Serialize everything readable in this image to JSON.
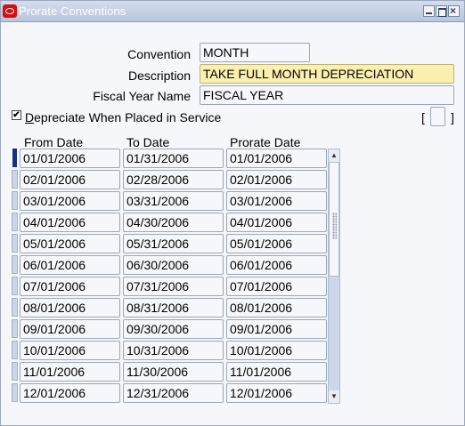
{
  "window": {
    "title": "Prorate Conventions",
    "close_glyph": "×"
  },
  "form": {
    "convention_label": "Convention",
    "convention_value": "MONTH",
    "description_label": "Description",
    "description_value": "TAKE FULL MONTH DEPRECIATION",
    "fiscal_year_label": "Fiscal Year Name",
    "fiscal_year_value": "FISCAL YEAR",
    "depreciate_checked": true,
    "depreciate_check_glyph": "✔",
    "depreciate_label_mnemonic": "D",
    "depreciate_label_rest": "epreciate When Placed in Service",
    "flexfield_open": "[",
    "flexfield_close": "]"
  },
  "table": {
    "headers": {
      "from": "From Date",
      "to": "To Date",
      "prorate": "Prorate Date"
    },
    "rows": [
      {
        "from": "01/01/2006",
        "to": "01/31/2006",
        "prorate": "01/01/2006"
      },
      {
        "from": "02/01/2006",
        "to": "02/28/2006",
        "prorate": "02/01/2006"
      },
      {
        "from": "03/01/2006",
        "to": "03/31/2006",
        "prorate": "03/01/2006"
      },
      {
        "from": "04/01/2006",
        "to": "04/30/2006",
        "prorate": "04/01/2006"
      },
      {
        "from": "05/01/2006",
        "to": "05/31/2006",
        "prorate": "05/01/2006"
      },
      {
        "from": "06/01/2006",
        "to": "06/30/2006",
        "prorate": "06/01/2006"
      },
      {
        "from": "07/01/2006",
        "to": "07/31/2006",
        "prorate": "07/01/2006"
      },
      {
        "from": "08/01/2006",
        "to": "08/31/2006",
        "prorate": "08/01/2006"
      },
      {
        "from": "09/01/2006",
        "to": "09/30/2006",
        "prorate": "09/01/2006"
      },
      {
        "from": "10/01/2006",
        "to": "10/31/2006",
        "prorate": "10/01/2006"
      },
      {
        "from": "11/01/2006",
        "to": "11/30/2006",
        "prorate": "11/01/2006"
      },
      {
        "from": "12/01/2006",
        "to": "12/31/2006",
        "prorate": "12/01/2006"
      }
    ],
    "current_row": 0
  },
  "scrollbar": {
    "up_glyph": "▲",
    "down_glyph": "▼",
    "thumb_fraction": 0.5
  },
  "colors": {
    "required_field": "#fcf0b0",
    "titlebar": "#c6d2e6",
    "current_row_marker": "#1a2e86",
    "logo": "#d50f0f"
  },
  "icons": [
    "oracle-logo-icon",
    "minimize-icon",
    "maximize-icon",
    "close-icon",
    "scroll-up-icon",
    "scroll-down-icon"
  ]
}
